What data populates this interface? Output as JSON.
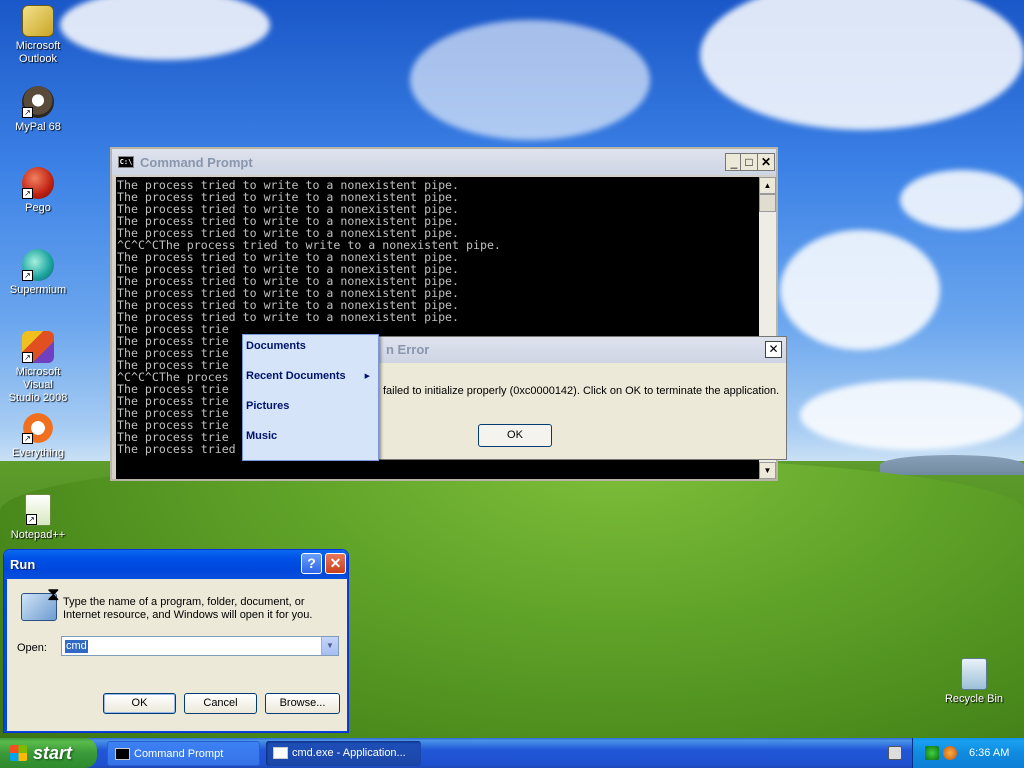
{
  "desktop": {
    "icons": [
      {
        "label1": "Microsoft",
        "label2": "Outlook"
      },
      {
        "label1": "MyPal 68",
        "label2": ""
      },
      {
        "label1": "Pego",
        "label2": ""
      },
      {
        "label1": "Supermium",
        "label2": ""
      },
      {
        "label1": "Microsoft Visual",
        "label2": "Studio 2008"
      },
      {
        "label1": "Everything",
        "label2": ""
      },
      {
        "label1": "Notepad++",
        "label2": ""
      },
      {
        "label1": "Recycle Bin",
        "label2": ""
      }
    ]
  },
  "cmd_window": {
    "title": "Command Prompt",
    "icon_text": "C:\\",
    "minimize": "_",
    "maximize": "□",
    "close": "✕",
    "lines": [
      "The process tried to write to a nonexistent pipe.",
      "The process tried to write to a nonexistent pipe.",
      "The process tried to write to a nonexistent pipe.",
      "The process tried to write to a nonexistent pipe.",
      "The process tried to write to a nonexistent pipe.",
      "^C^C^CThe process tried to write to a nonexistent pipe.",
      "The process tried to write to a nonexistent pipe.",
      "The process tried to write to a nonexistent pipe.",
      "The process tried to write to a nonexistent pipe.",
      "The process tried to write to a nonexistent pipe.",
      "The process tried to write to a nonexistent pipe.",
      "The process tried to write to a nonexistent pipe.",
      "The process trie",
      "The process trie",
      "The process trie",
      "The process trie",
      "^C^C^CThe proces",
      "The process trie",
      "The process trie",
      "The process trie",
      "The process trie",
      "The process trie",
      "The process tried to write to a nonexistent pipe."
    ]
  },
  "error_dialog": {
    "title": "n Error",
    "close": "✕",
    "message": "failed to initialize properly (0xc0000142). Click on OK to terminate the application.",
    "ok_label": "OK"
  },
  "context_menu": {
    "items": [
      {
        "label": "Documents",
        "submenu": false
      },
      {
        "label": "Recent Documents",
        "submenu": true
      },
      {
        "label": "Pictures",
        "submenu": false
      },
      {
        "label": "Music",
        "submenu": false
      }
    ],
    "submenu_arrow": "▶"
  },
  "run_dialog": {
    "title": "Run",
    "help": "?",
    "close": "✕",
    "description": "Type the name of a program, folder, document, or Internet resource, and Windows will open it for you.",
    "open_label": "Open:",
    "open_value": "cmd",
    "dropdown_arrow": "▼",
    "ok_label": "OK",
    "cancel_label": "Cancel",
    "browse_label": "Browse..."
  },
  "taskbar": {
    "start_label": "start",
    "tasks": [
      {
        "label": "Command Prompt",
        "active": false
      },
      {
        "label": "cmd.exe - Application...",
        "active": true
      }
    ],
    "clock": "6:36 AM"
  },
  "colors": {
    "taskbar_blue": "#1e51d0",
    "start_green": "#3a9a38",
    "tray_blue": "#0f8be0",
    "console_bg": "#000000",
    "console_fg": "#c0c0c0",
    "menu_bg": "#d5e4f9"
  }
}
